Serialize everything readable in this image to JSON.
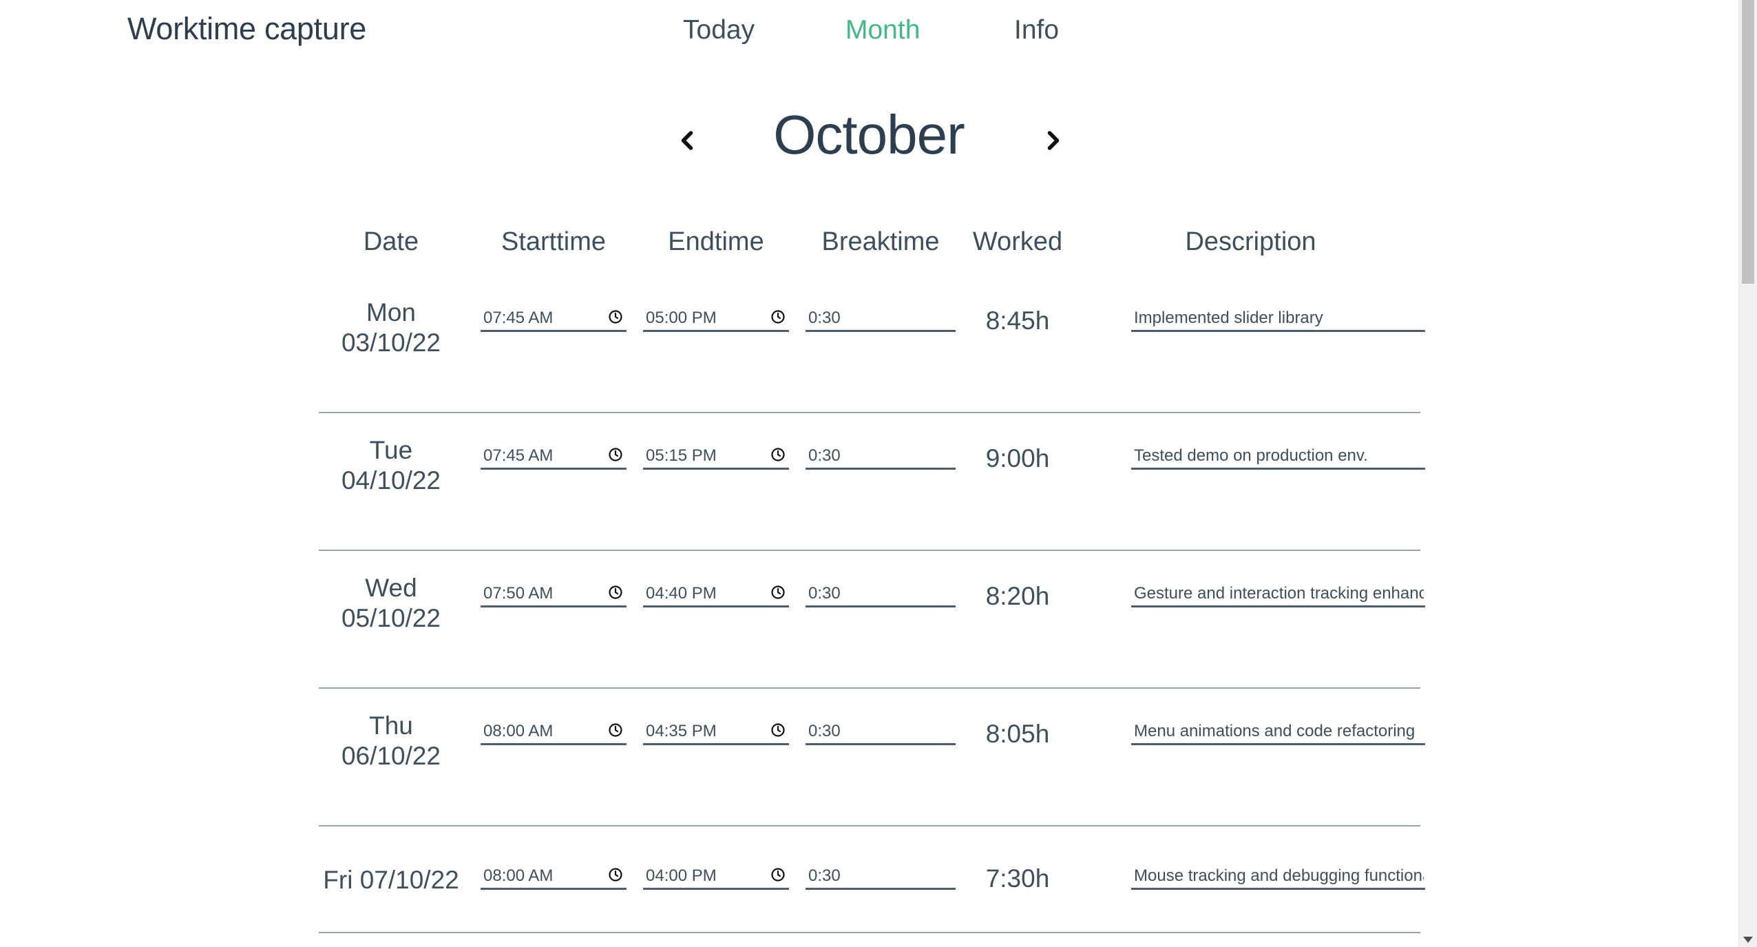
{
  "header": {
    "brand": "Worktime capture",
    "nav": [
      {
        "label": "Today",
        "active": false
      },
      {
        "label": "Month",
        "active": true
      },
      {
        "label": "Info",
        "active": false
      }
    ]
  },
  "month": {
    "title": "October",
    "prev_icon": "chevron-left-icon",
    "next_icon": "chevron-right-icon"
  },
  "table": {
    "headers": {
      "date": "Date",
      "start": "Starttime",
      "end": "Endtime",
      "break": "Breaktime",
      "worked": "Worked",
      "description": "Description"
    },
    "rows": [
      {
        "day": "Mon",
        "date": "03/10/22",
        "start": "07:45 AM",
        "end": "05:00 PM",
        "break": "0:30",
        "worked": "8:45h",
        "description": "Implemented slider library"
      },
      {
        "day": "Tue",
        "date": "04/10/22",
        "start": "07:45 AM",
        "end": "05:15 PM",
        "break": "0:30",
        "worked": "9:00h",
        "description": "Tested demo on production env."
      },
      {
        "day": "Wed",
        "date": "05/10/22",
        "start": "07:50 AM",
        "end": "04:40 PM",
        "break": "0:30",
        "worked": "8:20h",
        "description": "Gesture and interaction tracking enhance"
      },
      {
        "day": "Thu",
        "date": "06/10/22",
        "start": "08:00 AM",
        "end": "04:35 PM",
        "break": "0:30",
        "worked": "8:05h",
        "description": "Menu animations and code refactoring"
      },
      {
        "day": "Fri",
        "date": "07/10/22",
        "start": "08:00 AM",
        "end": "04:00 PM",
        "break": "0:30",
        "worked": "7:30h",
        "description": "Mouse tracking and debugging functional"
      }
    ]
  },
  "colors": {
    "accent": "#42b983",
    "text": "#2c3e50"
  }
}
